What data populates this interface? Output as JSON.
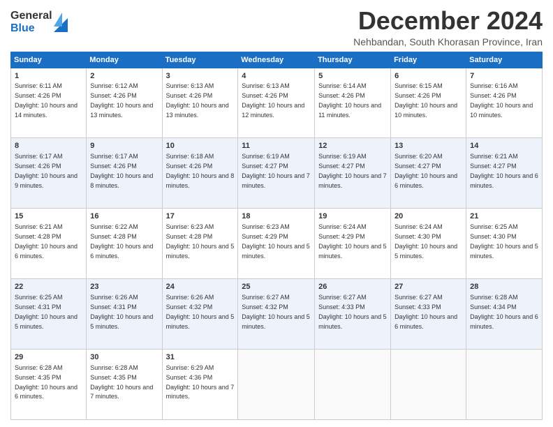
{
  "logo": {
    "general": "General",
    "blue": "Blue"
  },
  "header": {
    "title": "December 2024",
    "subtitle": "Nehbandan, South Khorasan Province, Iran"
  },
  "weekdays": [
    "Sunday",
    "Monday",
    "Tuesday",
    "Wednesday",
    "Thursday",
    "Friday",
    "Saturday"
  ],
  "weeks": [
    [
      {
        "day": "1",
        "sunrise": "6:11 AM",
        "sunset": "4:26 PM",
        "daylight": "10 hours and 14 minutes."
      },
      {
        "day": "2",
        "sunrise": "6:12 AM",
        "sunset": "4:26 PM",
        "daylight": "10 hours and 13 minutes."
      },
      {
        "day": "3",
        "sunrise": "6:13 AM",
        "sunset": "4:26 PM",
        "daylight": "10 hours and 13 minutes."
      },
      {
        "day": "4",
        "sunrise": "6:13 AM",
        "sunset": "4:26 PM",
        "daylight": "10 hours and 12 minutes."
      },
      {
        "day": "5",
        "sunrise": "6:14 AM",
        "sunset": "4:26 PM",
        "daylight": "10 hours and 11 minutes."
      },
      {
        "day": "6",
        "sunrise": "6:15 AM",
        "sunset": "4:26 PM",
        "daylight": "10 hours and 10 minutes."
      },
      {
        "day": "7",
        "sunrise": "6:16 AM",
        "sunset": "4:26 PM",
        "daylight": "10 hours and 10 minutes."
      }
    ],
    [
      {
        "day": "8",
        "sunrise": "6:17 AM",
        "sunset": "4:26 PM",
        "daylight": "10 hours and 9 minutes."
      },
      {
        "day": "9",
        "sunrise": "6:17 AM",
        "sunset": "4:26 PM",
        "daylight": "10 hours and 8 minutes."
      },
      {
        "day": "10",
        "sunrise": "6:18 AM",
        "sunset": "4:26 PM",
        "daylight": "10 hours and 8 minutes."
      },
      {
        "day": "11",
        "sunrise": "6:19 AM",
        "sunset": "4:27 PM",
        "daylight": "10 hours and 7 minutes."
      },
      {
        "day": "12",
        "sunrise": "6:19 AM",
        "sunset": "4:27 PM",
        "daylight": "10 hours and 7 minutes."
      },
      {
        "day": "13",
        "sunrise": "6:20 AM",
        "sunset": "4:27 PM",
        "daylight": "10 hours and 6 minutes."
      },
      {
        "day": "14",
        "sunrise": "6:21 AM",
        "sunset": "4:27 PM",
        "daylight": "10 hours and 6 minutes."
      }
    ],
    [
      {
        "day": "15",
        "sunrise": "6:21 AM",
        "sunset": "4:28 PM",
        "daylight": "10 hours and 6 minutes."
      },
      {
        "day": "16",
        "sunrise": "6:22 AM",
        "sunset": "4:28 PM",
        "daylight": "10 hours and 6 minutes."
      },
      {
        "day": "17",
        "sunrise": "6:23 AM",
        "sunset": "4:28 PM",
        "daylight": "10 hours and 5 minutes."
      },
      {
        "day": "18",
        "sunrise": "6:23 AM",
        "sunset": "4:29 PM",
        "daylight": "10 hours and 5 minutes."
      },
      {
        "day": "19",
        "sunrise": "6:24 AM",
        "sunset": "4:29 PM",
        "daylight": "10 hours and 5 minutes."
      },
      {
        "day": "20",
        "sunrise": "6:24 AM",
        "sunset": "4:30 PM",
        "daylight": "10 hours and 5 minutes."
      },
      {
        "day": "21",
        "sunrise": "6:25 AM",
        "sunset": "4:30 PM",
        "daylight": "10 hours and 5 minutes."
      }
    ],
    [
      {
        "day": "22",
        "sunrise": "6:25 AM",
        "sunset": "4:31 PM",
        "daylight": "10 hours and 5 minutes."
      },
      {
        "day": "23",
        "sunrise": "6:26 AM",
        "sunset": "4:31 PM",
        "daylight": "10 hours and 5 minutes."
      },
      {
        "day": "24",
        "sunrise": "6:26 AM",
        "sunset": "4:32 PM",
        "daylight": "10 hours and 5 minutes."
      },
      {
        "day": "25",
        "sunrise": "6:27 AM",
        "sunset": "4:32 PM",
        "daylight": "10 hours and 5 minutes."
      },
      {
        "day": "26",
        "sunrise": "6:27 AM",
        "sunset": "4:33 PM",
        "daylight": "10 hours and 5 minutes."
      },
      {
        "day": "27",
        "sunrise": "6:27 AM",
        "sunset": "4:33 PM",
        "daylight": "10 hours and 6 minutes."
      },
      {
        "day": "28",
        "sunrise": "6:28 AM",
        "sunset": "4:34 PM",
        "daylight": "10 hours and 6 minutes."
      }
    ],
    [
      {
        "day": "29",
        "sunrise": "6:28 AM",
        "sunset": "4:35 PM",
        "daylight": "10 hours and 6 minutes."
      },
      {
        "day": "30",
        "sunrise": "6:28 AM",
        "sunset": "4:35 PM",
        "daylight": "10 hours and 7 minutes."
      },
      {
        "day": "31",
        "sunrise": "6:29 AM",
        "sunset": "4:36 PM",
        "daylight": "10 hours and 7 minutes."
      },
      null,
      null,
      null,
      null
    ]
  ]
}
